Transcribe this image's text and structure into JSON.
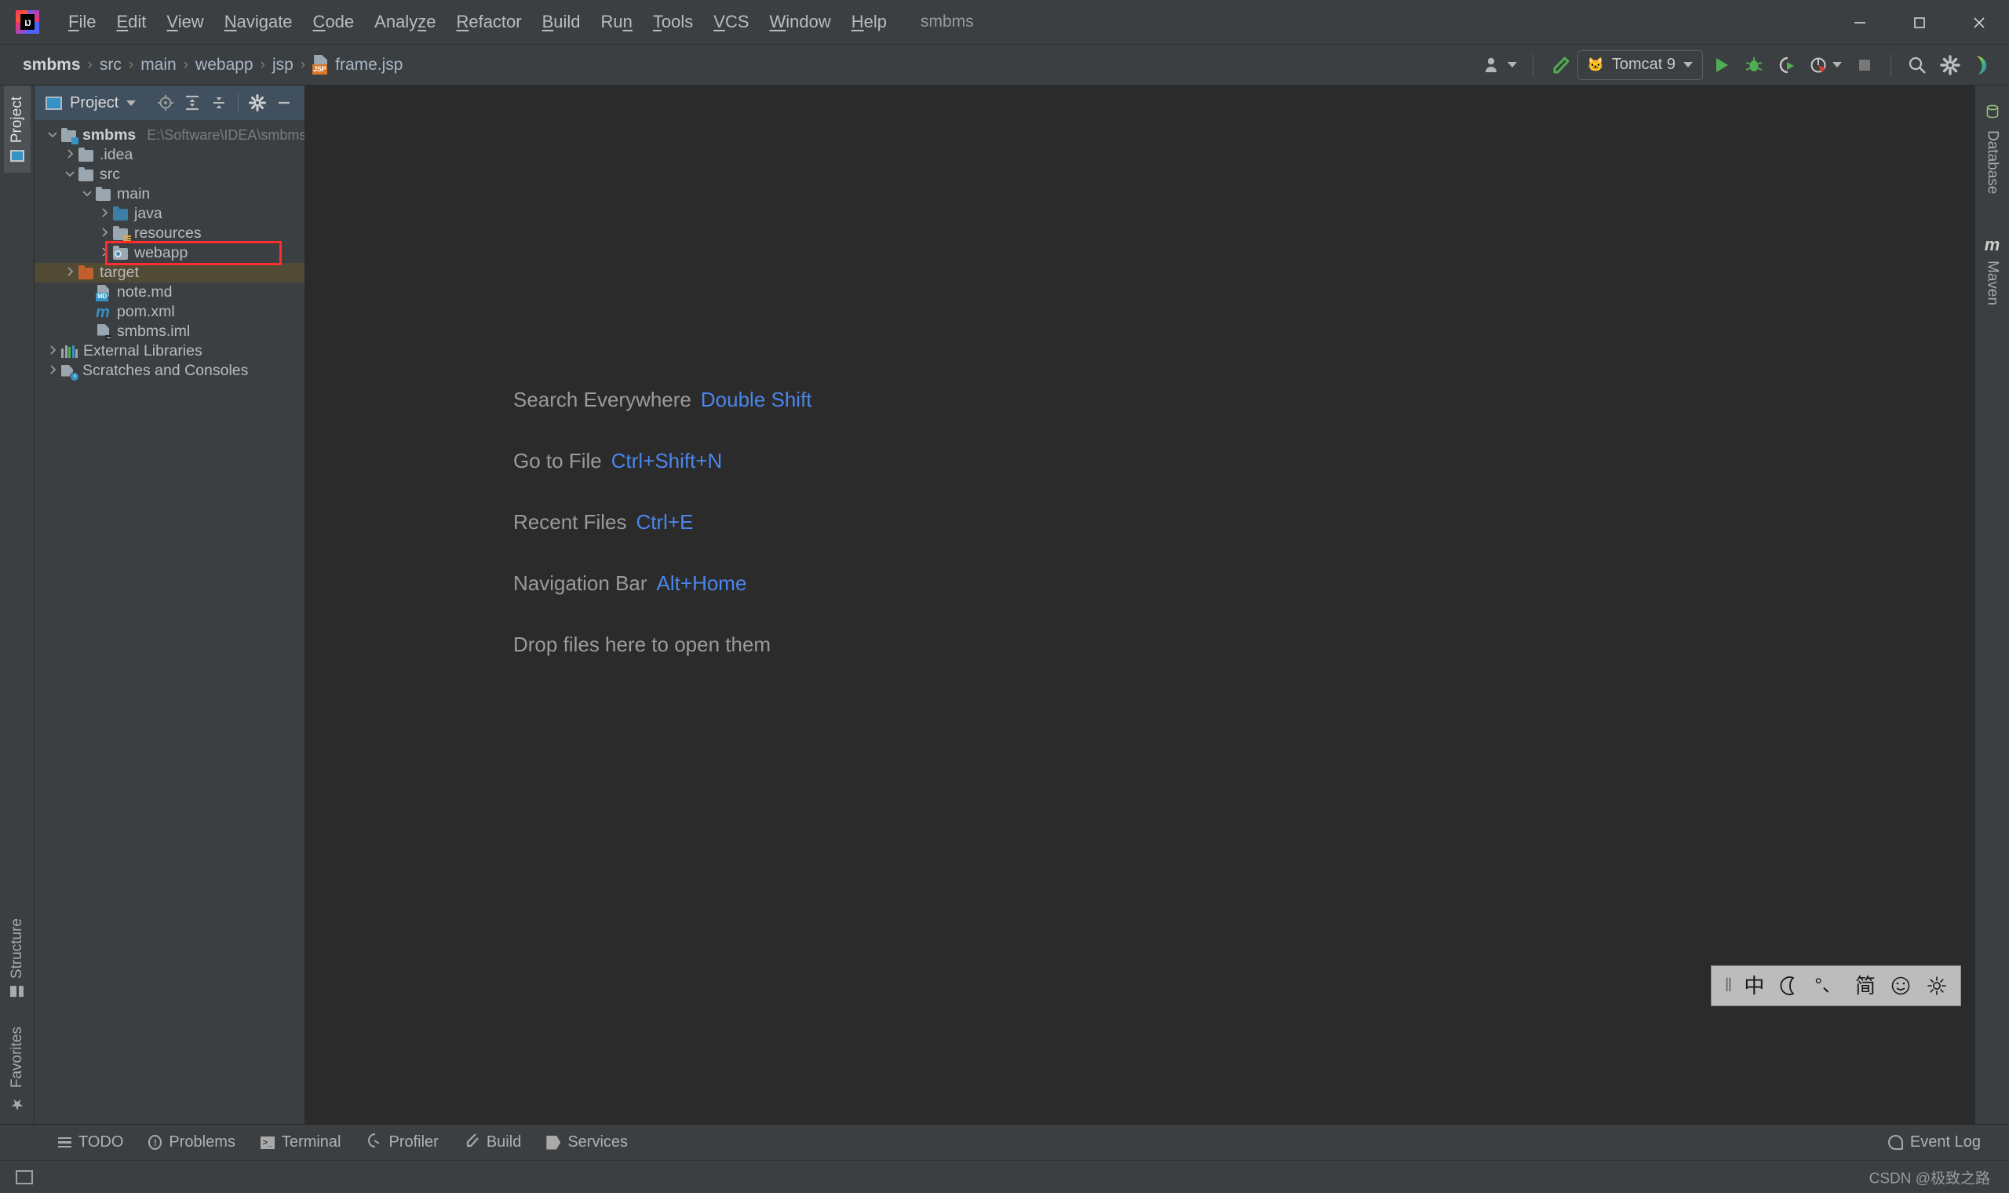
{
  "window": {
    "project_title": "smbms",
    "minimize": "—",
    "maximize": "☐",
    "close": "✕"
  },
  "menubar": {
    "logo": "IJ",
    "items": [
      {
        "label": "File",
        "mnemonic": "F"
      },
      {
        "label": "Edit",
        "mnemonic": "E"
      },
      {
        "label": "View",
        "mnemonic": "V"
      },
      {
        "label": "Navigate",
        "mnemonic": "N"
      },
      {
        "label": "Code",
        "mnemonic": "C"
      },
      {
        "label": "Analyze",
        "mnemonic": "z"
      },
      {
        "label": "Refactor",
        "mnemonic": "R"
      },
      {
        "label": "Build",
        "mnemonic": "B"
      },
      {
        "label": "Run",
        "mnemonic": "n"
      },
      {
        "label": "Tools",
        "mnemonic": "T"
      },
      {
        "label": "VCS",
        "mnemonic": "V"
      },
      {
        "label": "Window",
        "mnemonic": "W"
      },
      {
        "label": "Help",
        "mnemonic": "H"
      }
    ]
  },
  "navbar": {
    "breadcrumb": [
      {
        "label": "smbms",
        "bold": true,
        "icon": ""
      },
      {
        "label": "src",
        "bold": false,
        "icon": ""
      },
      {
        "label": "main",
        "bold": false,
        "icon": ""
      },
      {
        "label": "webapp",
        "bold": false,
        "icon": ""
      },
      {
        "label": "jsp",
        "bold": false,
        "icon": ""
      },
      {
        "label": "frame.jsp",
        "bold": false,
        "icon": "jsp-file-icon"
      }
    ],
    "separator": "›",
    "jsp_badge": "JSP"
  },
  "toolbar": {
    "user_icon": "user-avatar-icon",
    "build_icon": "build-hammer-icon",
    "run_config": {
      "label": "Tomcat 9",
      "icon": "tomcat-icon",
      "icon_glyph": "🐱"
    },
    "run_icon": "run-icon",
    "debug_icon": "debug-icon",
    "run_coverage_icon": "run-with-coverage-icon",
    "profile_icon": "profiler-icon",
    "stop_icon": "stop-icon",
    "search_icon": "search-icon",
    "settings_icon": "settings-gear-icon",
    "ide_icon": "ide-feature-icon"
  },
  "left_stripe": {
    "top": [
      {
        "label": "Project",
        "icon": "project-window-icon",
        "active": true
      }
    ],
    "bottom": [
      {
        "label": "Structure",
        "icon": "structure-icon"
      },
      {
        "label": "Favorites",
        "icon": "favorites-star-icon"
      }
    ]
  },
  "right_stripe": {
    "items": [
      {
        "label": "Database",
        "icon": "database-icon"
      },
      {
        "label": "Maven",
        "icon": "maven-m-icon"
      }
    ]
  },
  "project_panel": {
    "title": "Project",
    "title_caret": "▼",
    "header_icons": [
      {
        "name": "select-opened-file-icon"
      },
      {
        "name": "expand-all-icon"
      },
      {
        "name": "collapse-all-icon"
      },
      {
        "name": "settings-gear-icon"
      },
      {
        "name": "hide-panel-icon"
      }
    ],
    "tree": [
      {
        "label": "smbms",
        "path": "E:\\Software\\IDEA\\smbms",
        "indent": 0,
        "chevron": "down",
        "icon": "module-folder-icon",
        "bold": true,
        "highlight": "none"
      },
      {
        "label": ".idea",
        "path": "",
        "indent": 1,
        "chevron": "right",
        "icon": "folder-icon",
        "bold": false,
        "highlight": "none"
      },
      {
        "label": "src",
        "path": "",
        "indent": 1,
        "chevron": "down",
        "icon": "folder-icon",
        "bold": false,
        "highlight": "none"
      },
      {
        "label": "main",
        "path": "",
        "indent": 2,
        "chevron": "down",
        "icon": "folder-icon",
        "bold": false,
        "highlight": "none"
      },
      {
        "label": "java",
        "path": "",
        "indent": 3,
        "chevron": "right",
        "icon": "source-folder-icon",
        "bold": false,
        "highlight": "none"
      },
      {
        "label": "resources",
        "path": "",
        "indent": 3,
        "chevron": "right",
        "icon": "resources-folder-icon",
        "bold": false,
        "highlight": "none"
      },
      {
        "label": "webapp",
        "path": "",
        "indent": 3,
        "chevron": "right",
        "icon": "webapp-folder-icon",
        "bold": false,
        "highlight": "annotated"
      },
      {
        "label": "target",
        "path": "",
        "indent": 1,
        "chevron": "right",
        "icon": "excluded-folder-icon",
        "bold": false,
        "highlight": "olive"
      },
      {
        "label": "note.md",
        "path": "",
        "indent": 2,
        "chevron": "none",
        "icon": "markdown-file-icon",
        "bold": false,
        "highlight": "none"
      },
      {
        "label": "pom.xml",
        "path": "",
        "indent": 2,
        "chevron": "none",
        "icon": "maven-pom-icon",
        "bold": false,
        "highlight": "none"
      },
      {
        "label": "smbms.iml",
        "path": "",
        "indent": 2,
        "chevron": "none",
        "icon": "iml-file-icon",
        "bold": false,
        "highlight": "none"
      },
      {
        "label": "External Libraries",
        "path": "",
        "indent": 0,
        "chevron": "right",
        "icon": "external-libraries-icon",
        "bold": false,
        "highlight": "none"
      },
      {
        "label": "Scratches and Consoles",
        "path": "",
        "indent": 0,
        "chevron": "right",
        "icon": "scratches-icon",
        "bold": false,
        "highlight": "none"
      }
    ],
    "badges": {
      "md": "MD"
    }
  },
  "editor_hints": [
    {
      "action": "Search Everywhere",
      "shortcut": "Double Shift"
    },
    {
      "action": "Go to File",
      "shortcut": "Ctrl+Shift+N"
    },
    {
      "action": "Recent Files",
      "shortcut": "Ctrl+E"
    },
    {
      "action": "Navigation Bar",
      "shortcut": "Alt+Home"
    },
    {
      "action": "Drop files here to open them",
      "shortcut": ""
    }
  ],
  "ime_bar": {
    "grip": "‖",
    "items": [
      {
        "name": "language-mode-chinese",
        "glyph": "中"
      },
      {
        "name": "moon-mode-icon",
        "glyph": "☾"
      },
      {
        "name": "punctuation-mode-icon",
        "glyph": "°、"
      },
      {
        "name": "simplified-chinese-icon",
        "glyph": "简"
      },
      {
        "name": "emoji-icon",
        "glyph": "☺"
      },
      {
        "name": "ime-settings-gear-icon",
        "glyph": "⚙"
      }
    ]
  },
  "statusbar": {
    "tools": [
      {
        "label": "TODO",
        "icon": "todo-icon"
      },
      {
        "label": "Problems",
        "icon": "problems-icon"
      },
      {
        "label": "Terminal",
        "icon": "terminal-icon"
      },
      {
        "label": "Profiler",
        "icon": "profiler-icon"
      },
      {
        "label": "Build",
        "icon": "build-icon"
      },
      {
        "label": "Services",
        "icon": "services-icon"
      }
    ],
    "event_log": {
      "label": "Event Log",
      "icon": "event-log-icon"
    }
  },
  "footer": {
    "icon": "ide-status-icon",
    "watermark": "CSDN @极致之路"
  },
  "colors": {
    "accent_blue": "#4b86ec",
    "annotation_red": "#ff2d2d",
    "panel_header": "#41505e",
    "editor_bg": "#2b2b2b",
    "chrome_bg": "#3c3f41",
    "olive_highlight": "#514b36"
  }
}
